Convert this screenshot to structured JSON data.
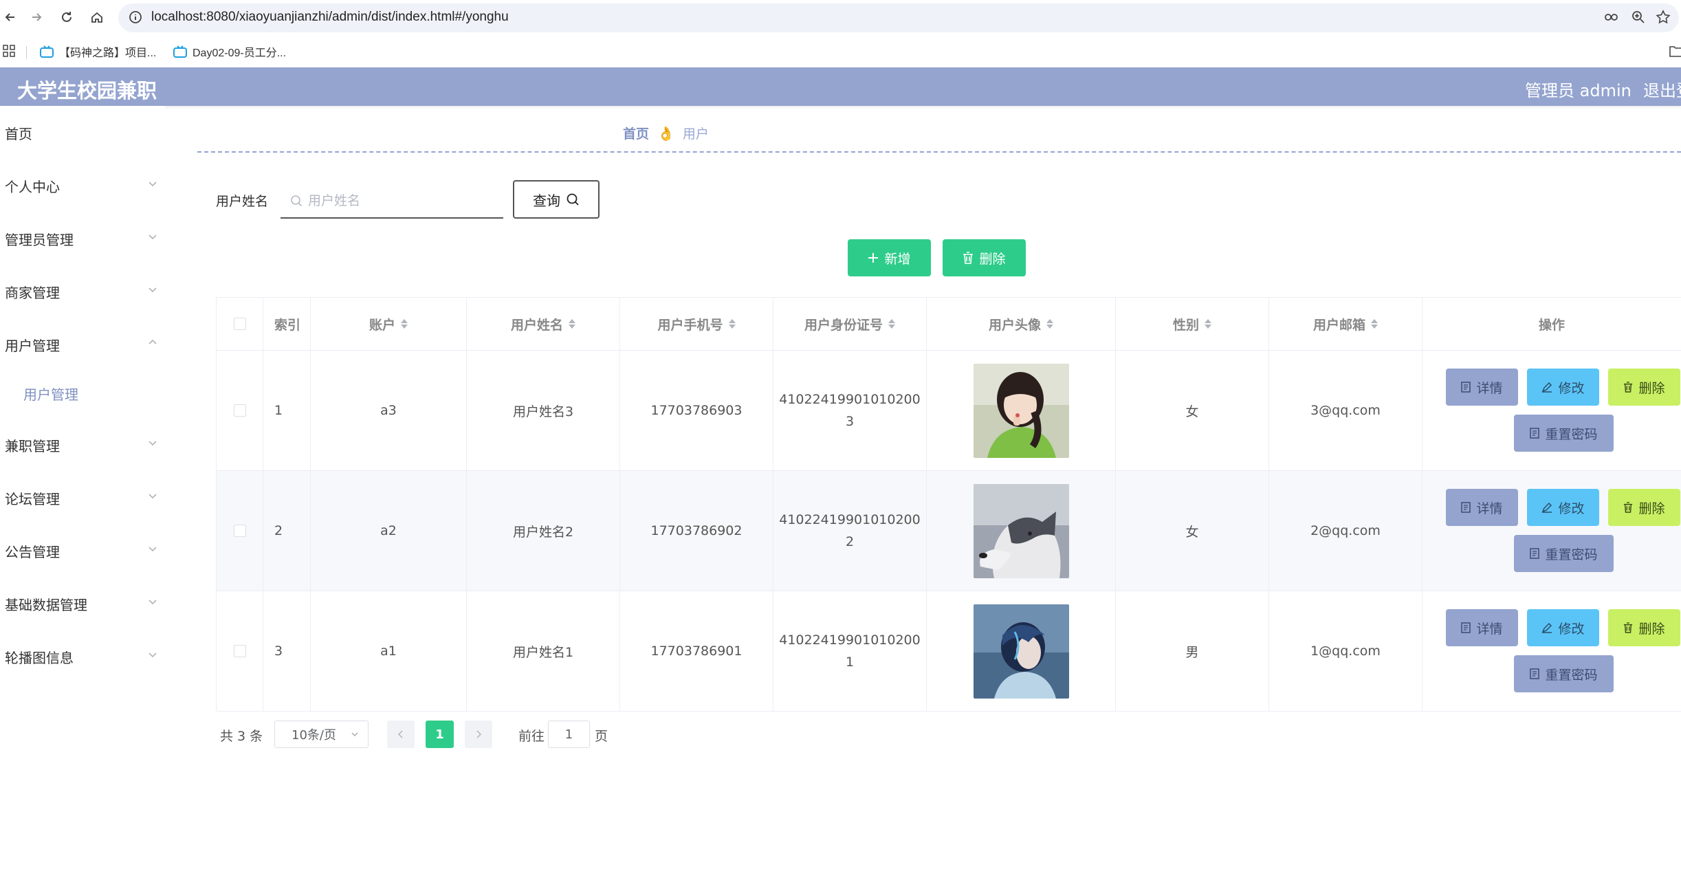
{
  "browser": {
    "url_host": "localhost",
    "url_rest": ":8080/xiaoyuanjianzhi/admin/dist/index.html#/yonghu",
    "bookmarks": [
      "【码神之路】项目...",
      "Day02-09-员工分..."
    ]
  },
  "header": {
    "title": "大学生校园兼职",
    "user": "管理员 admin",
    "logout": "退出登"
  },
  "sidebar": {
    "items": [
      {
        "label": "首页"
      },
      {
        "label": "个人中心"
      },
      {
        "label": "管理员管理"
      },
      {
        "label": "商家管理"
      },
      {
        "label": "用户管理"
      },
      {
        "label": "兼职管理"
      },
      {
        "label": "论坛管理"
      },
      {
        "label": "公告管理"
      },
      {
        "label": "基础数据管理"
      },
      {
        "label": "轮播图信息"
      }
    ],
    "sub_item": "用户管理"
  },
  "breadcrumb": {
    "home": "首页",
    "current": "用户"
  },
  "search": {
    "label": "用户姓名",
    "placeholder": "用户姓名",
    "query_button": "查询"
  },
  "actions": {
    "add": "新增",
    "delete": "删除"
  },
  "table": {
    "columns": [
      "索引",
      "账户",
      "用户姓名",
      "用户手机号",
      "用户身份证号",
      "用户头像",
      "性别",
      "用户邮箱",
      "操作"
    ],
    "rows": [
      {
        "index": "1",
        "account": "a3",
        "name": "用户姓名3",
        "phone": "17703786903",
        "id_line1": "41022419901010200",
        "id_line2": "3",
        "avatar": "girl-photo",
        "gender": "女",
        "email": "3@qq.com"
      },
      {
        "index": "2",
        "account": "a2",
        "name": "用户姓名2",
        "phone": "17703786902",
        "id_line1": "41022419901010200",
        "id_line2": "2",
        "avatar": "husky-photo",
        "gender": "女",
        "email": "2@qq.com"
      },
      {
        "index": "3",
        "account": "a1",
        "name": "用户姓名1",
        "phone": "17703786901",
        "id_line1": "41022419901010200",
        "id_line2": "1",
        "avatar": "anime-boy-photo",
        "gender": "男",
        "email": "1@qq.com"
      }
    ],
    "ops": {
      "detail": "详情",
      "edit": "修改",
      "delete": "删除",
      "reset": "重置密码"
    }
  },
  "pagination": {
    "total": "共 3 条",
    "page_size": "10条/页",
    "current_page": "1",
    "goto_label": "前往",
    "goto_value": "1",
    "page_suffix": "页"
  },
  "colors": {
    "header_bg": "#94a4cf",
    "primary_green": "#2ecc8a",
    "detail_btn": "#94a4cf",
    "edit_btn": "#5bc4f7",
    "delete_btn": "#c8f062"
  }
}
